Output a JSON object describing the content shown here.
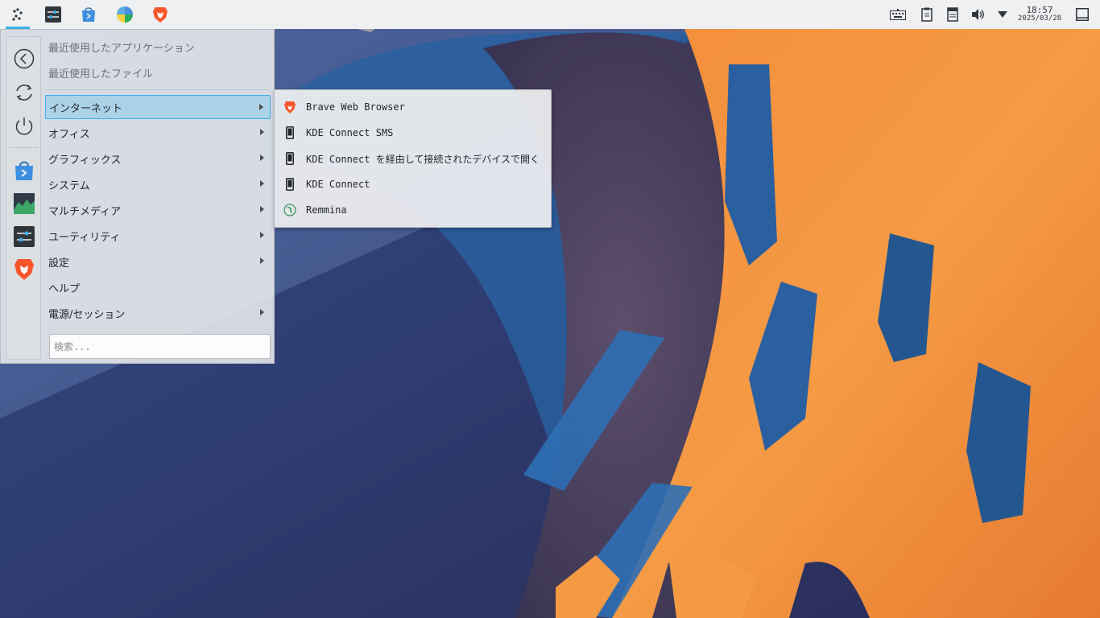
{
  "panel": {
    "launchers": [
      {
        "id": "application-launcher",
        "icon": "kde-launcher-icon"
      },
      {
        "id": "system-settings",
        "icon": "settings-sliders-icon"
      },
      {
        "id": "discover",
        "icon": "store-bag-icon"
      },
      {
        "id": "filelight",
        "icon": "pie-chart-icon"
      },
      {
        "id": "brave",
        "icon": "brave-lion-icon"
      }
    ],
    "tray": [
      "keyboard-icon",
      "clipboard-icon",
      "notes-icon",
      "volume-icon",
      "expand-arrow-icon",
      "desktop-icon"
    ],
    "clock": {
      "time": "18:57",
      "date": "2025/03/28"
    }
  },
  "menu": {
    "side_buttons": [
      "back-icon",
      "refresh-icon",
      "power-icon",
      "discover-icon",
      "system-monitor-icon",
      "system-settings-icon",
      "brave-icon"
    ],
    "recent_apps": "最近使用したアプリケーション",
    "recent_files": "最近使用したファイル",
    "categories": [
      {
        "label": "インターネット",
        "has_submenu": true
      },
      {
        "label": "オフィス",
        "has_submenu": true
      },
      {
        "label": "グラフィックス",
        "has_submenu": true
      },
      {
        "label": "システム",
        "has_submenu": true
      },
      {
        "label": "マルチメディア",
        "has_submenu": true
      },
      {
        "label": "ユーティリティ",
        "has_submenu": true
      },
      {
        "label": "設定",
        "has_submenu": true
      },
      {
        "label": "ヘルプ",
        "has_submenu": false
      },
      {
        "label": "電源/セッション",
        "has_submenu": true
      }
    ],
    "search_placeholder": "検索..."
  },
  "submenu": {
    "items": [
      {
        "label": "Brave Web Browser",
        "icon": "brave-icon"
      },
      {
        "label": "KDE Connect SMS",
        "icon": "phone-icon"
      },
      {
        "label": "KDE Connect を経由して接続されたデバイスで開く",
        "icon": "phone-icon"
      },
      {
        "label": "KDE Connect",
        "icon": "phone-icon"
      },
      {
        "label": "Remmina",
        "icon": "remmina-icon"
      }
    ]
  },
  "colors": {
    "panel_bg": "#eff0f1",
    "accent": "#3daee9",
    "highlight": "#93cee9",
    "wallpaper_blue": "#2a5fa0",
    "wallpaper_orange": "#f0923a",
    "wallpaper_dark": "#2c2f4a"
  }
}
